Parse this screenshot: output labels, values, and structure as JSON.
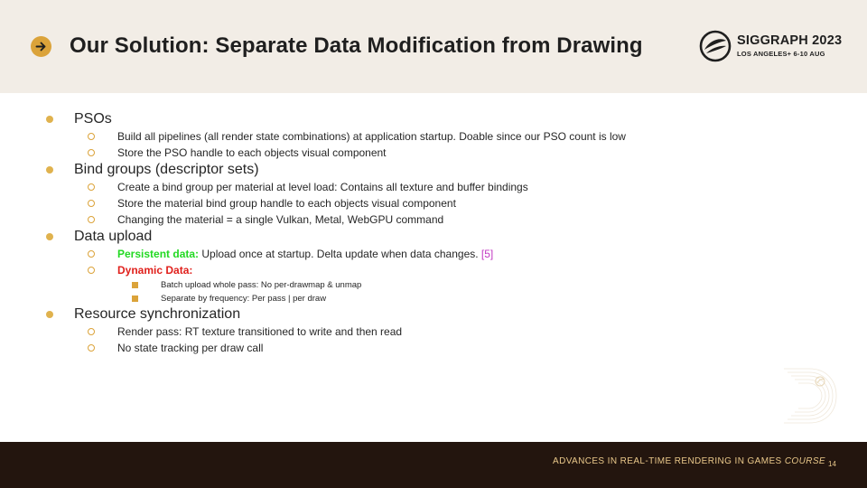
{
  "title": "Our Solution: Separate Data Modification from Drawing",
  "logo": {
    "name": "SIGGRAPH 2023",
    "subtitle": "LOS ANGELES+  6-10 AUG"
  },
  "bullets": {
    "pso": {
      "label": "PSOs",
      "items": [
        "Build all pipelines (all render state combinations) at application startup. Doable since our PSO count is low",
        "Store the PSO handle to each objects visual component"
      ]
    },
    "bind": {
      "label": "Bind groups (descriptor sets)",
      "items": [
        "Create a bind group per material at level load: Contains all texture and buffer bindings",
        "Store the material bind group handle to each objects visual component",
        "Changing the material = a single Vulkan, Metal, WebGPU command"
      ]
    },
    "upload": {
      "label": "Data upload",
      "persistent_label": "Persistent data:",
      "persistent_text": " Upload once at startup. Delta update when data changes. ",
      "persistent_cite": "[5]",
      "dynamic_label": "Dynamic Data:",
      "dynamic_items": [
        "Batch upload whole pass: No per-drawmap & unmap",
        "Separate by frequency: Per pass | per draw"
      ]
    },
    "sync": {
      "label": "Resource synchronization",
      "items": [
        "Render pass: RT texture transitioned to write and then read",
        "No state tracking per draw call"
      ]
    }
  },
  "footer": {
    "course_text": "ADVANCES IN REAL-TIME RENDERING IN GAMES ",
    "course_em": "COURSE",
    "page": "14"
  },
  "colors": {
    "header_bg": "#f2ede6",
    "accent": "#dba33a",
    "footer_bg": "#23150e",
    "footer_text": "#e9c88a",
    "persistent": "#22d922",
    "dynamic": "#e0201c",
    "citation": "#c238c2"
  },
  "icons": {
    "title": "arrow-right-icon",
    "logo": "siggraph-logo-icon",
    "watermark": "decorative-watermark-icon"
  }
}
